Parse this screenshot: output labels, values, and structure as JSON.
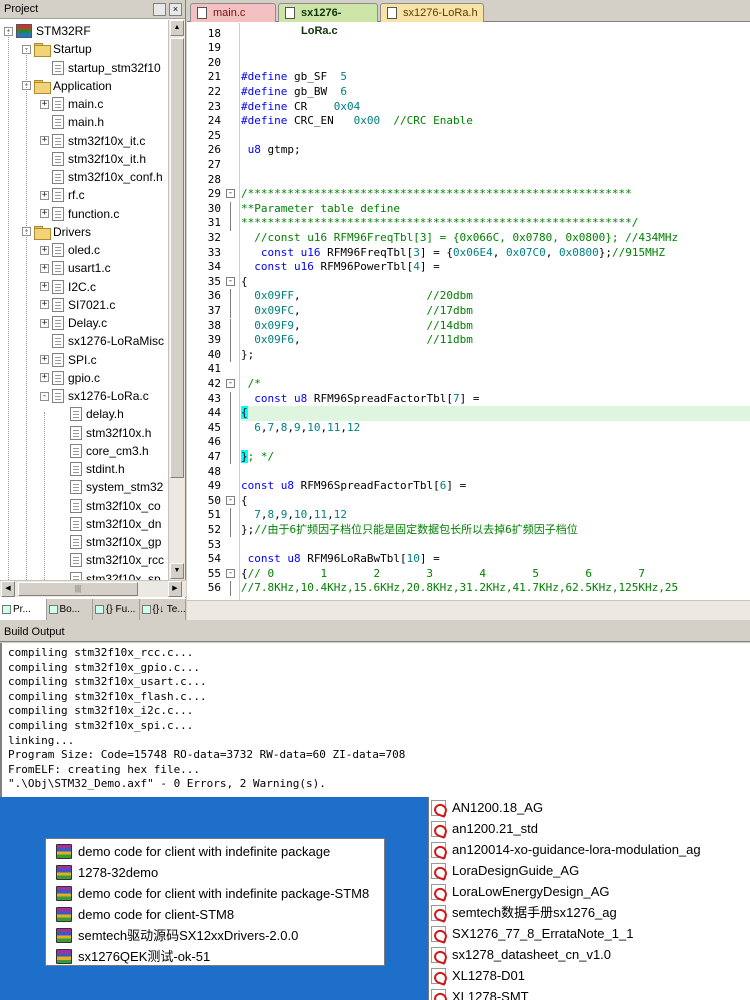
{
  "project": {
    "title": "Project",
    "pin_glyph": "ᅟ",
    "close_glyph": "×",
    "root": "STM32RF",
    "groups": [
      {
        "name": "Startup",
        "files": [
          {
            "name": "startup_stm32f10",
            "expandable": false
          }
        ]
      },
      {
        "name": "Application",
        "files": [
          {
            "name": "main.c",
            "expandable": true
          },
          {
            "name": "main.h",
            "expandable": false
          },
          {
            "name": "stm32f10x_it.c",
            "expandable": true
          },
          {
            "name": "stm32f10x_it.h",
            "expandable": false
          },
          {
            "name": "stm32f10x_conf.h",
            "expandable": false
          },
          {
            "name": "rf.c",
            "expandable": true
          },
          {
            "name": "function.c",
            "expandable": true
          }
        ]
      },
      {
        "name": "Drivers",
        "files": [
          {
            "name": "oled.c",
            "expandable": true
          },
          {
            "name": "usart1.c",
            "expandable": true
          },
          {
            "name": "I2C.c",
            "expandable": true
          },
          {
            "name": "SI7021.c",
            "expandable": true
          },
          {
            "name": "Delay.c",
            "expandable": true
          },
          {
            "name": "sx1276-LoRaMisc",
            "expandable": false
          },
          {
            "name": "SPI.c",
            "expandable": true
          },
          {
            "name": "gpio.c",
            "expandable": true
          },
          {
            "name": "sx1276-LoRa.c",
            "expandable": true,
            "expanded": true,
            "children": [
              "delay.h",
              "stm32f10x.h",
              "core_cm3.h",
              "stdint.h",
              "system_stm32",
              "stm32f10x_co",
              "stm32f10x_dn",
              "stm32f10x_gp",
              "stm32f10x_rcc",
              "stm32f10x_sp"
            ]
          }
        ]
      }
    ],
    "bottom_tabs": [
      "Pr...",
      "Bo...",
      "{} Fu...",
      "{}↓ Te..."
    ]
  },
  "editor": {
    "tabs": [
      {
        "label": "main.c"
      },
      {
        "label": "sx1276-LoRa.c",
        "active": true
      },
      {
        "label": "sx1276-LoRa.h"
      }
    ],
    "lines": [
      {
        "n": 18,
        "text": ""
      },
      {
        "n": 19,
        "text": ""
      },
      {
        "n": 20,
        "text": ""
      },
      {
        "n": 21,
        "text": "#define gb_SF  5"
      },
      {
        "n": 22,
        "text": "#define gb_BW  6"
      },
      {
        "n": 23,
        "text": "#define CR    0x04"
      },
      {
        "n": 24,
        "text": "#define CRC_EN   0x00  //CRC Enable"
      },
      {
        "n": 25,
        "text": ""
      },
      {
        "n": 26,
        "text": " u8 gtmp;"
      },
      {
        "n": 27,
        "text": ""
      },
      {
        "n": 28,
        "text": ""
      },
      {
        "n": 29,
        "text": "/**********************************************************"
      },
      {
        "n": 30,
        "text": "**Parameter table define"
      },
      {
        "n": 31,
        "text": "***********************************************************/"
      },
      {
        "n": 32,
        "text": "  //const u16 RFM96FreqTbl[3] = {0x066C, 0x0780, 0x0800}; //434MHz"
      },
      {
        "n": 33,
        "text": "   const u16 RFM96FreqTbl[3] = {0x06E4, 0x07C0, 0x0800};//915MHZ"
      },
      {
        "n": 34,
        "text": "  const u16 RFM96PowerTbl[4] ="
      },
      {
        "n": 35,
        "text": "{"
      },
      {
        "n": 36,
        "text": "  0x09FF,                   //20dbm"
      },
      {
        "n": 37,
        "text": "  0x09FC,                   //17dbm"
      },
      {
        "n": 38,
        "text": "  0x09F9,                   //14dbm"
      },
      {
        "n": 39,
        "text": "  0x09F6,                   //11dbm"
      },
      {
        "n": 40,
        "text": "};"
      },
      {
        "n": 41,
        "text": ""
      },
      {
        "n": 42,
        "text": " /*"
      },
      {
        "n": 43,
        "text": "  const u8 RFM96SpreadFactorTbl[7] ="
      },
      {
        "n": 44,
        "text": "{"
      },
      {
        "n": 45,
        "text": "  6,7,8,9,10,11,12"
      },
      {
        "n": 46,
        "text": ""
      },
      {
        "n": 47,
        "text": "}; */"
      },
      {
        "n": 48,
        "text": ""
      },
      {
        "n": 49,
        "text": "const u8 RFM96SpreadFactorTbl[6] ="
      },
      {
        "n": 50,
        "text": "{"
      },
      {
        "n": 51,
        "text": "  7,8,9,10,11,12"
      },
      {
        "n": 52,
        "text": "};//由于6扩频因子档位只能是固定数据包长所以去掉6扩频因子档位"
      },
      {
        "n": 53,
        "text": ""
      },
      {
        "n": 54,
        "text": " const u8 RFM96LoRaBwTbl[10] ="
      },
      {
        "n": 55,
        "text": "{// 0       1       2       3       4       5       6       7"
      },
      {
        "n": 56,
        "text": "//7.8KHz,10.4KHz,15.6KHz,20.8KHz,31.2KHz,41.7KHz,62.5KHz,125KHz,25"
      }
    ]
  },
  "build": {
    "title": "Build Output",
    "lines": [
      "compiling stm32f10x_rcc.c...",
      "compiling stm32f10x_gpio.c...",
      "compiling stm32f10x_usart.c...",
      "compiling stm32f10x_flash.c...",
      "compiling stm32f10x_i2c.c...",
      "compiling stm32f10x_spi.c...",
      "linking...",
      "Program Size: Code=15748 RO-data=3732 RW-data=60 ZI-data=708",
      "FromELF: creating hex file...",
      "\".\\Obj\\STM32_Demo.axf\" - 0 Errors, 2 Warning(s)."
    ]
  },
  "desktop": {
    "left_list": [
      "demo code for client with indefinite package",
      "1278-32demo",
      "demo code for client with indefinite package-STM8",
      "demo code for client-STM8",
      "semtech驱动源码SX12xxDrivers-2.0.0",
      "sx1276QEK测试-ok-51"
    ],
    "right_list": [
      "AN1200.18_AG",
      "an1200.21_std",
      "an120014-xo-guidance-lora-modulation_ag",
      "LoraDesignGuide_AG",
      "LoraLowEnergyDesign_AG",
      "semtech数据手册sx1276_ag",
      "SX1276_77_8_ErrataNote_1_1",
      "sx1278_datasheet_cn_v1.0",
      "XL1278-D01",
      "XL1278-SMT"
    ]
  }
}
